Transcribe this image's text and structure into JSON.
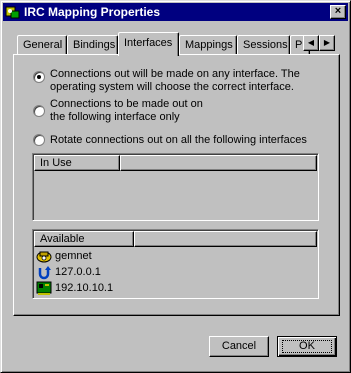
{
  "window": {
    "title": "IRC Mapping Properties",
    "close_label": "×"
  },
  "tabs": [
    {
      "label": "General"
    },
    {
      "label": "Bindings"
    },
    {
      "label": "Interfaces",
      "active": true
    },
    {
      "label": "Mappings"
    },
    {
      "label": "Sessions"
    },
    {
      "label": "P"
    }
  ],
  "tab_scroll": {
    "left": "◀",
    "right": "▶"
  },
  "options": [
    {
      "line1": "Connections out will be made on any interface.  The",
      "line2": "operating system will choose the correct interface.",
      "selected": true
    },
    {
      "line1": "Connections to be made out on",
      "line2": "the following interface only",
      "selected": false
    },
    {
      "line1": "Rotate connections out on all the following interfaces",
      "selected": false
    }
  ],
  "interface_combo": {
    "value": "",
    "enabled": false
  },
  "in_use_list": {
    "header": "In Use",
    "items": []
  },
  "available_list": {
    "header": "Available",
    "items": [
      {
        "label": "gemnet",
        "icon": "phone-dialup-icon"
      },
      {
        "label": "127.0.0.1",
        "icon": "loopback-icon"
      },
      {
        "label": "192.10.10.1",
        "icon": "network-card-icon"
      }
    ]
  },
  "buttons": {
    "cancel": "Cancel",
    "ok": "OK"
  }
}
